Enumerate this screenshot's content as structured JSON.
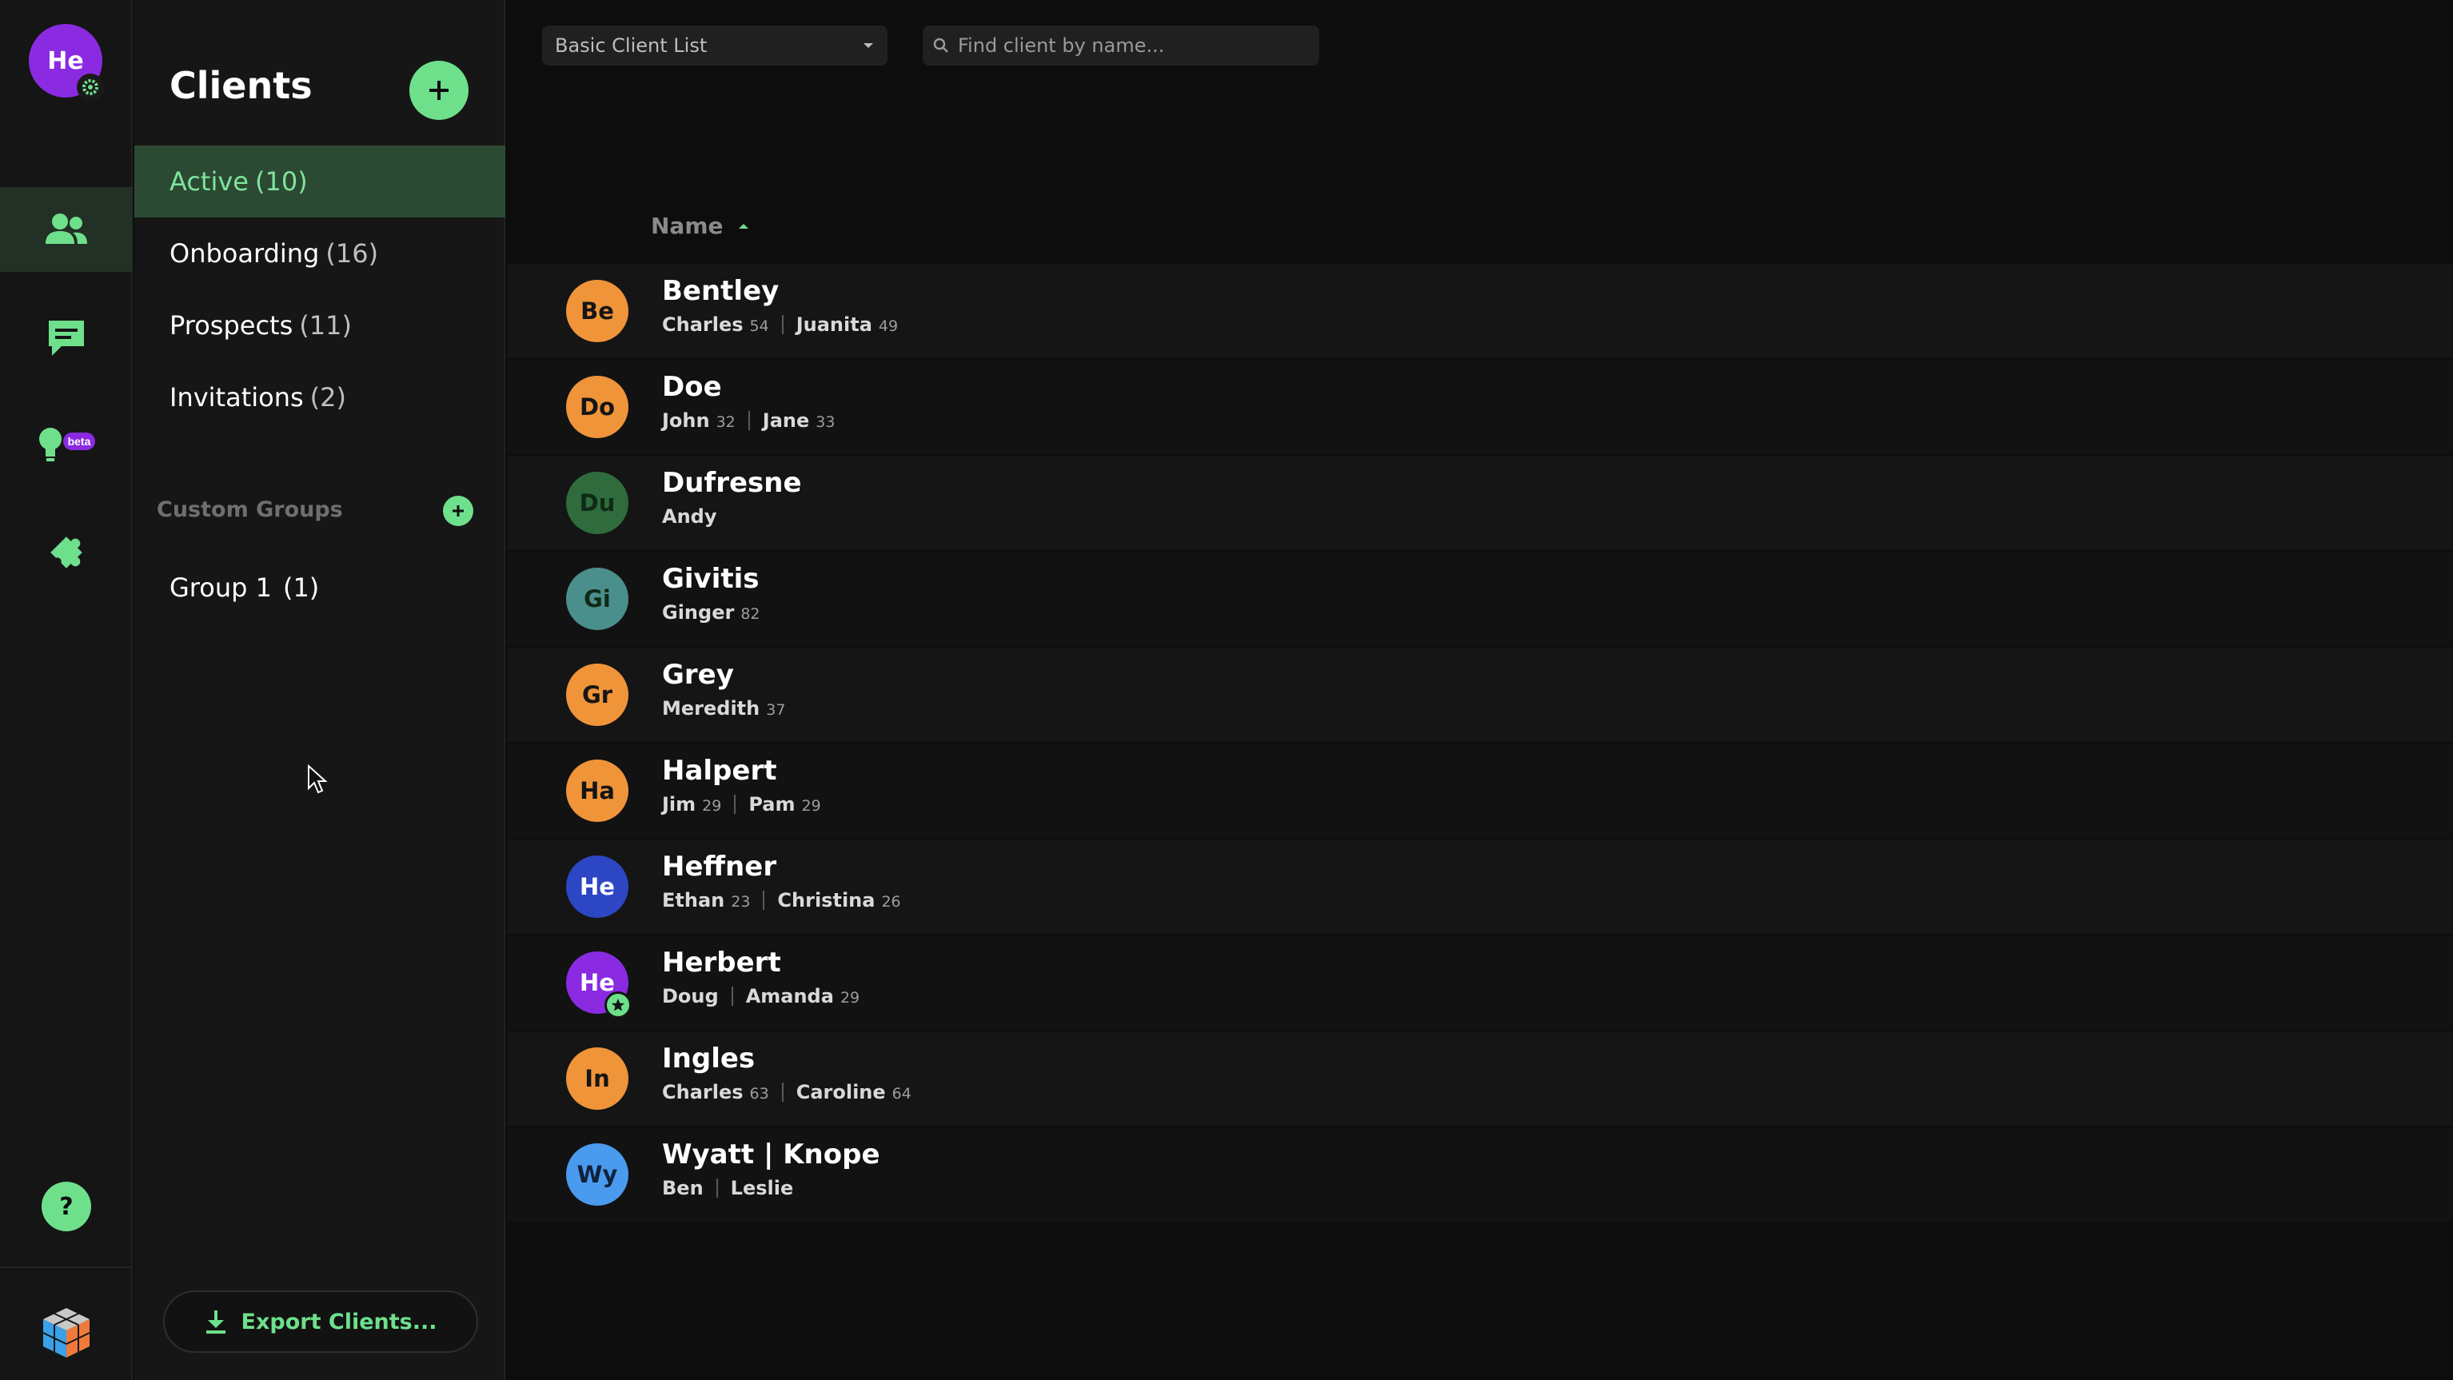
{
  "rail": {
    "user_avatar": "He",
    "icons": [
      "users-icon",
      "chat-icon",
      "lightbulb-beta-icon",
      "puzzle-icon"
    ],
    "beta_label": "beta",
    "help_label": "?"
  },
  "sidebar": {
    "title": "Clients",
    "nav": [
      {
        "label": "Active",
        "count": "(10)"
      },
      {
        "label": "Onboarding",
        "count": "(16)"
      },
      {
        "label": "Prospects",
        "count": "(11)"
      },
      {
        "label": "Invitations",
        "count": "(2)"
      }
    ],
    "custom_groups_label": "Custom Groups",
    "groups": [
      {
        "label": "Group 1",
        "count": "(1)"
      }
    ],
    "export_label": "Export Clients..."
  },
  "main": {
    "view_select": "Basic Client List",
    "search_placeholder": "Find client by name...",
    "column_header": "Name"
  },
  "clients": [
    {
      "initials": "Be",
      "color": "#f0943a",
      "name": "Bentley",
      "members": [
        {
          "n": "Charles",
          "a": "54"
        },
        {
          "n": "Juanita",
          "a": "49"
        }
      ]
    },
    {
      "initials": "Do",
      "color": "#f0943a",
      "name": "Doe",
      "members": [
        {
          "n": "John",
          "a": "32"
        },
        {
          "n": "Jane",
          "a": "33"
        }
      ]
    },
    {
      "initials": "Du",
      "color": "#2f6b3c",
      "name": "Dufresne",
      "members": [
        {
          "n": "Andy",
          "a": ""
        }
      ]
    },
    {
      "initials": "Gi",
      "color": "#4a8f8c",
      "name": "Givitis",
      "members": [
        {
          "n": "Ginger",
          "a": "82"
        }
      ]
    },
    {
      "initials": "Gr",
      "color": "#f0943a",
      "name": "Grey",
      "members": [
        {
          "n": "Meredith",
          "a": "37"
        }
      ]
    },
    {
      "initials": "Ha",
      "color": "#f0943a",
      "name": "Halpert",
      "members": [
        {
          "n": "Jim",
          "a": "29"
        },
        {
          "n": "Pam",
          "a": "29"
        }
      ]
    },
    {
      "initials": "He",
      "color": "#2d46c4",
      "name": "Heffner",
      "members": [
        {
          "n": "Ethan",
          "a": "23"
        },
        {
          "n": "Christina",
          "a": "26"
        }
      ]
    },
    {
      "initials": "He",
      "color": "#8a2be2",
      "name": "Herbert",
      "star": true,
      "members": [
        {
          "n": "Doug",
          "a": ""
        },
        {
          "n": "Amanda",
          "a": "29"
        }
      ]
    },
    {
      "initials": "In",
      "color": "#f0943a",
      "name": "Ingles",
      "members": [
        {
          "n": "Charles",
          "a": "63"
        },
        {
          "n": "Caroline",
          "a": "64"
        }
      ]
    },
    {
      "initials": "Wy",
      "color": "#4a9aee",
      "name": "Wyatt | Knope",
      "members": [
        {
          "n": "Ben",
          "a": ""
        },
        {
          "n": "Leslie",
          "a": ""
        }
      ]
    }
  ],
  "colors": {
    "accent": "#6ee08c",
    "active_bg": "#2c4a33"
  }
}
